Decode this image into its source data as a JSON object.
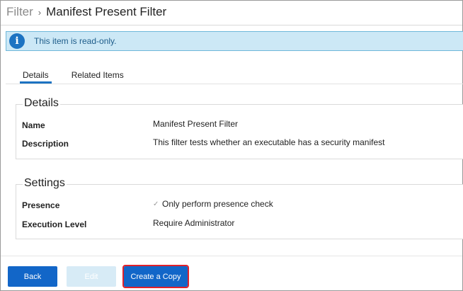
{
  "header": {
    "breadcrumb_parent": "Filter",
    "breadcrumb_separator": "›",
    "title": "Manifest Present Filter"
  },
  "banner": {
    "icon": "info-icon",
    "icon_glyph": "i",
    "text": "This item is read-only."
  },
  "tabs": [
    {
      "label": "Details",
      "active": true
    },
    {
      "label": "Related Items",
      "active": false
    }
  ],
  "details": {
    "title": "Details",
    "name_label": "Name",
    "name_value": "Manifest Present Filter",
    "description_label": "Description",
    "description_value": "This filter tests whether an executable has a security manifest"
  },
  "settings": {
    "title": "Settings",
    "presence_label": "Presence",
    "presence_checked": true,
    "presence_check_glyph": "✓",
    "presence_value": "Only perform presence check",
    "execution_label": "Execution Level",
    "execution_value": "Require Administrator"
  },
  "footer": {
    "back_label": "Back",
    "edit_label": "Edit",
    "edit_disabled": true,
    "copy_label": "Create a Copy",
    "copy_highlighted": true
  },
  "colors": {
    "accent": "#1266c8",
    "banner_bg": "#cce8f6",
    "highlight": "#e0212a"
  }
}
